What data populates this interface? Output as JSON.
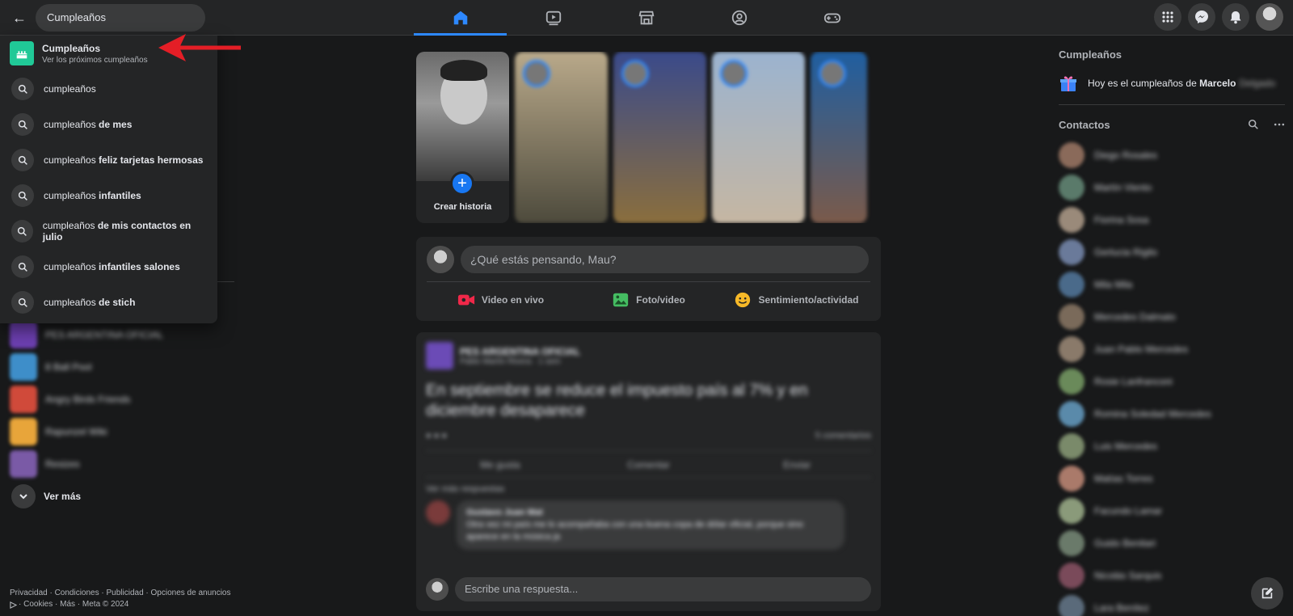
{
  "search": {
    "query": "Cumpleaños"
  },
  "dropdown": {
    "top": {
      "title": "Cumpleaños",
      "subtitle": "Ver los próximos cumpleaños"
    },
    "suggestions": [
      {
        "prefix": "cumpleaños",
        "bold": ""
      },
      {
        "prefix": "cumpleaños ",
        "bold": "de mes"
      },
      {
        "prefix": "cumpleaños ",
        "bold": "feliz tarjetas hermosas"
      },
      {
        "prefix": "cumpleaños ",
        "bold": "infantiles"
      },
      {
        "prefix": "cumpleaños ",
        "bold": "de mis contactos en julio"
      },
      {
        "prefix": "cumpleaños ",
        "bold": "infantiles salones"
      },
      {
        "prefix": "cumpleaños ",
        "bold": "de stich"
      }
    ]
  },
  "nav": {
    "tabs": [
      "home-icon",
      "video-icon",
      "marketplace-icon",
      "groups-icon",
      "gaming-icon"
    ]
  },
  "topright": {
    "icons": [
      "menu-grid-icon",
      "messenger-icon",
      "notifications-icon"
    ]
  },
  "left": {
    "shortcuts": [
      "PES ARGENTINA OFICIAL",
      "8 Ball Pool",
      "Angry Birds Friends",
      "Rapunzel Wiki",
      "Resizes"
    ],
    "see_more": "Ver más",
    "footer_line1": "Privacidad · Condiciones · Publicidad · Opciones de anuncios",
    "footer_line2": "· Cookies · Más · Meta © 2024"
  },
  "stories": {
    "create_label": "Crear historia"
  },
  "composer": {
    "placeholder": "¿Qué estás pensando, Mau?",
    "live": "Video en vivo",
    "photo": "Foto/video",
    "feeling": "Sentimiento/actividad"
  },
  "post": {
    "author": "PES ARGENTINA OFICIAL",
    "sub": "Pablo Martín Rivera · 1 sem",
    "text": "En septiembre se reduce el impuesto país al 7% y en diciembre desaparece",
    "comments_count": "5 comentarios",
    "like": "Me gusta",
    "comment": "Comentar",
    "share": "Enviar",
    "more_replies": "Ver más respuestas",
    "comment_author": "Gustavo Juan Mat",
    "comment_text": "Otra vez mi país me lo acompañaba con una buena copa de dólar oficial, porque sino aparece en la música ja",
    "reply_placeholder": "Escribe una respuesta..."
  },
  "right": {
    "birthdays_title": "Cumpleaños",
    "birthday_prefix": "Hoy es el cumpleaños de ",
    "birthday_name": "Marcelo",
    "birthday_surname": "Delgado",
    "contacts_title": "Contactos",
    "contacts": [
      "Diego Rosales",
      "Martín Viento",
      "Fiorina Sosa",
      "Gerlucia Rigilo",
      "Mila Mila",
      "Mercedes Dalmato",
      "Juan Pablo Mercedes",
      "Rosie Lanfranconi",
      "Romina Soledad Mercedes",
      "Luis Mercedes",
      "Matías Torres",
      "Facundo Lamar",
      "Guido Benitari",
      "Nicolás Sarquis",
      "Lara Benítez"
    ]
  },
  "colors": {
    "accent": "#2d88ff",
    "bg": "#18191a",
    "surface": "#242526",
    "arrow": "#e41e26",
    "cake": "#20c997"
  }
}
